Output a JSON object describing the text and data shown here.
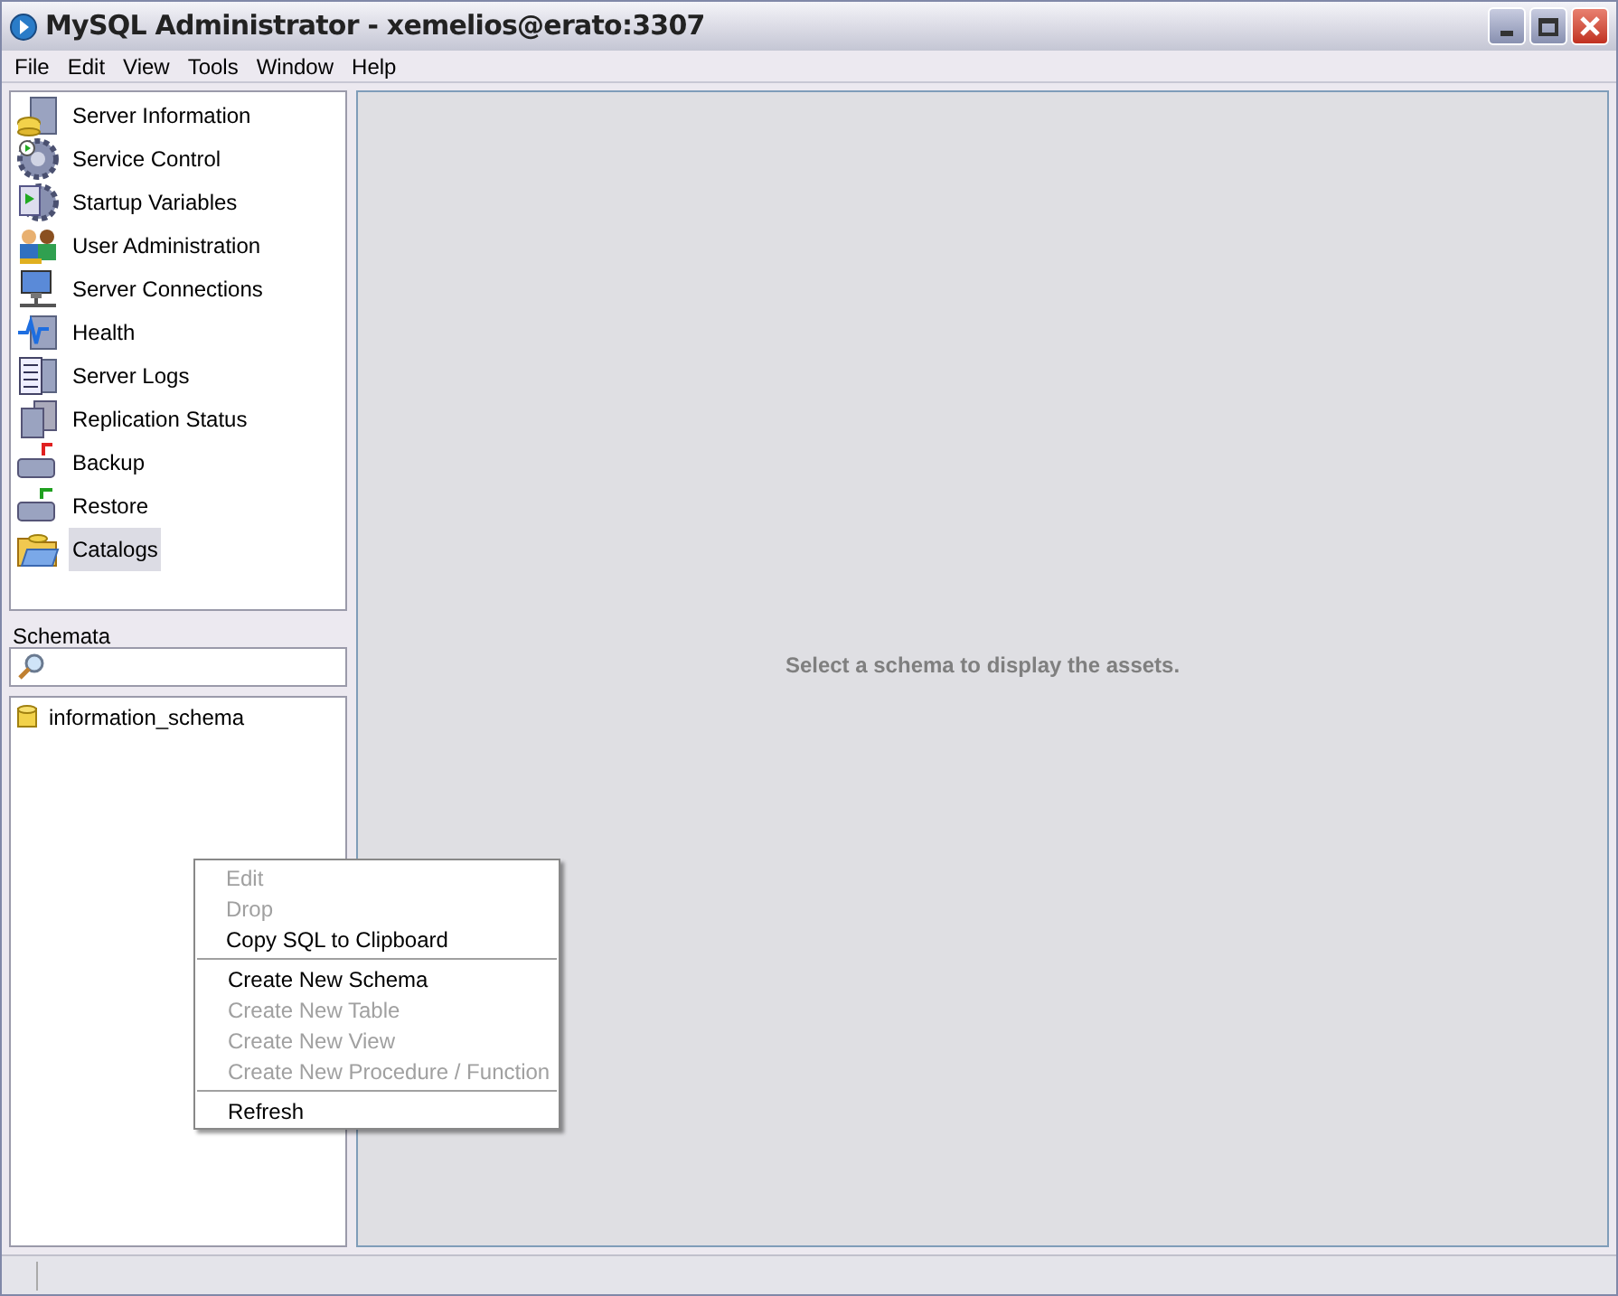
{
  "window": {
    "title": "MySQL Administrator - xemelios@erato:3307"
  },
  "menu_bar": [
    "File",
    "Edit",
    "View",
    "Tools",
    "Window",
    "Help"
  ],
  "sidebar": {
    "items": [
      {
        "label": "Server Information",
        "selected": false
      },
      {
        "label": "Service Control",
        "selected": false
      },
      {
        "label": "Startup Variables",
        "selected": false
      },
      {
        "label": "User Administration",
        "selected": false
      },
      {
        "label": "Server Connections",
        "selected": false
      },
      {
        "label": "Health",
        "selected": false
      },
      {
        "label": "Server Logs",
        "selected": false
      },
      {
        "label": "Replication Status",
        "selected": false
      },
      {
        "label": "Backup",
        "selected": false
      },
      {
        "label": "Restore",
        "selected": false
      },
      {
        "label": "Catalogs",
        "selected": true
      }
    ]
  },
  "schemata": {
    "label": "Schemata",
    "items": [
      "information_schema"
    ]
  },
  "main": {
    "message": "Select a schema to display the assets."
  },
  "context_menu": {
    "groups": [
      [
        {
          "label": "Edit",
          "disabled": true
        },
        {
          "label": "Drop",
          "disabled": true
        },
        {
          "label": "Copy SQL to Clipboard",
          "disabled": false
        }
      ],
      [
        {
          "label": "Create New Schema",
          "disabled": false
        },
        {
          "label": "Create New Table",
          "disabled": true
        },
        {
          "label": "Create New View",
          "disabled": true
        },
        {
          "label": "Create New Procedure / Function",
          "disabled": true
        }
      ],
      [
        {
          "label": "Refresh",
          "disabled": false
        }
      ]
    ]
  }
}
